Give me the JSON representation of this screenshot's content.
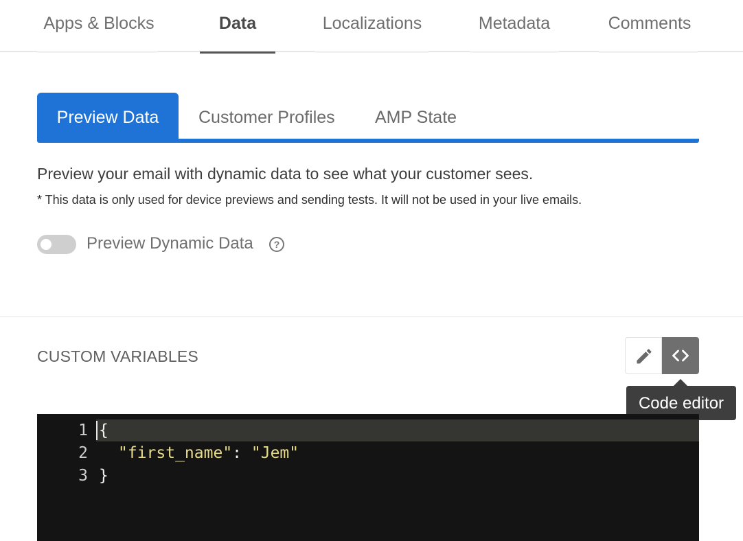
{
  "top_tabs": [
    "Apps & Blocks",
    "Data",
    "Localizations",
    "Metadata",
    "Comments"
  ],
  "top_tabs_active": "Data",
  "sub_tabs": [
    "Preview Data",
    "Customer Profiles",
    "AMP State"
  ],
  "sub_tabs_active": "Preview Data",
  "description": "Preview your email with dynamic data to see what your customer sees.",
  "note": "* This data is only used for device previews and sending tests. It will not be used in your live emails.",
  "toggle": {
    "label": "Preview Dynamic Data",
    "on": false,
    "help_icon": "question-circle-icon"
  },
  "custom_variables": {
    "title": "CUSTOM VARIABLES",
    "edit_icon": "pencil-icon",
    "code_icon": "code-brackets-icon",
    "tooltip": "Code editor"
  },
  "editor": {
    "lines": [
      {
        "num": "1",
        "text": "{"
      },
      {
        "num": "2",
        "key": "\"first_name\"",
        "sep": ": ",
        "value": "\"Jem\""
      },
      {
        "num": "3",
        "text": "}"
      }
    ]
  },
  "colors": {
    "accent": "#1f73d6",
    "editor_bg": "#141414",
    "string": "#e8dc8c",
    "tooltip_bg": "#3e3e3e"
  }
}
